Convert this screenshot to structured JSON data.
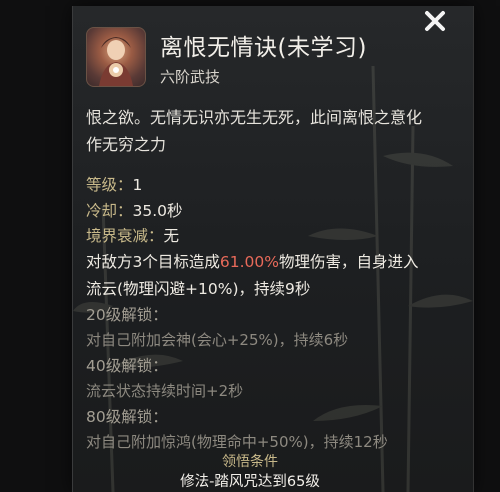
{
  "skill": {
    "name": "离恨无情诀(未学习)",
    "category": "六阶武技",
    "description": "恨之欲。无情无识亦无生无死，此间离恨之意化作无穷之力"
  },
  "stats": [
    {
      "label": "等级：",
      "value": "1"
    },
    {
      "label": "冷却：",
      "value": "35.0秒"
    },
    {
      "label": "境界衰减：",
      "value": "无"
    }
  ],
  "effect": {
    "pre": "对敌方3个目标造成",
    "highlight": "61.00%",
    "post": "物理伤害，自身进入流云(物理闪避+10%)，持续9秒",
    "highlight_color": "#e86a5a"
  },
  "unlocks": [
    {
      "label": "20级解锁：",
      "text": "对自己附加会神(会心+25%)，持续6秒"
    },
    {
      "label": "40级解锁：",
      "text": "流云状态持续时间+2秒"
    },
    {
      "label": "80级解锁：",
      "text": "对自己附加惊鸿(物理命中+50%)，持续12秒"
    }
  ],
  "condition": {
    "title": "领悟条件",
    "value": "修法-踏风咒达到65级"
  },
  "icons": {
    "close": "close-icon",
    "skill": "skill-portrait-icon"
  }
}
